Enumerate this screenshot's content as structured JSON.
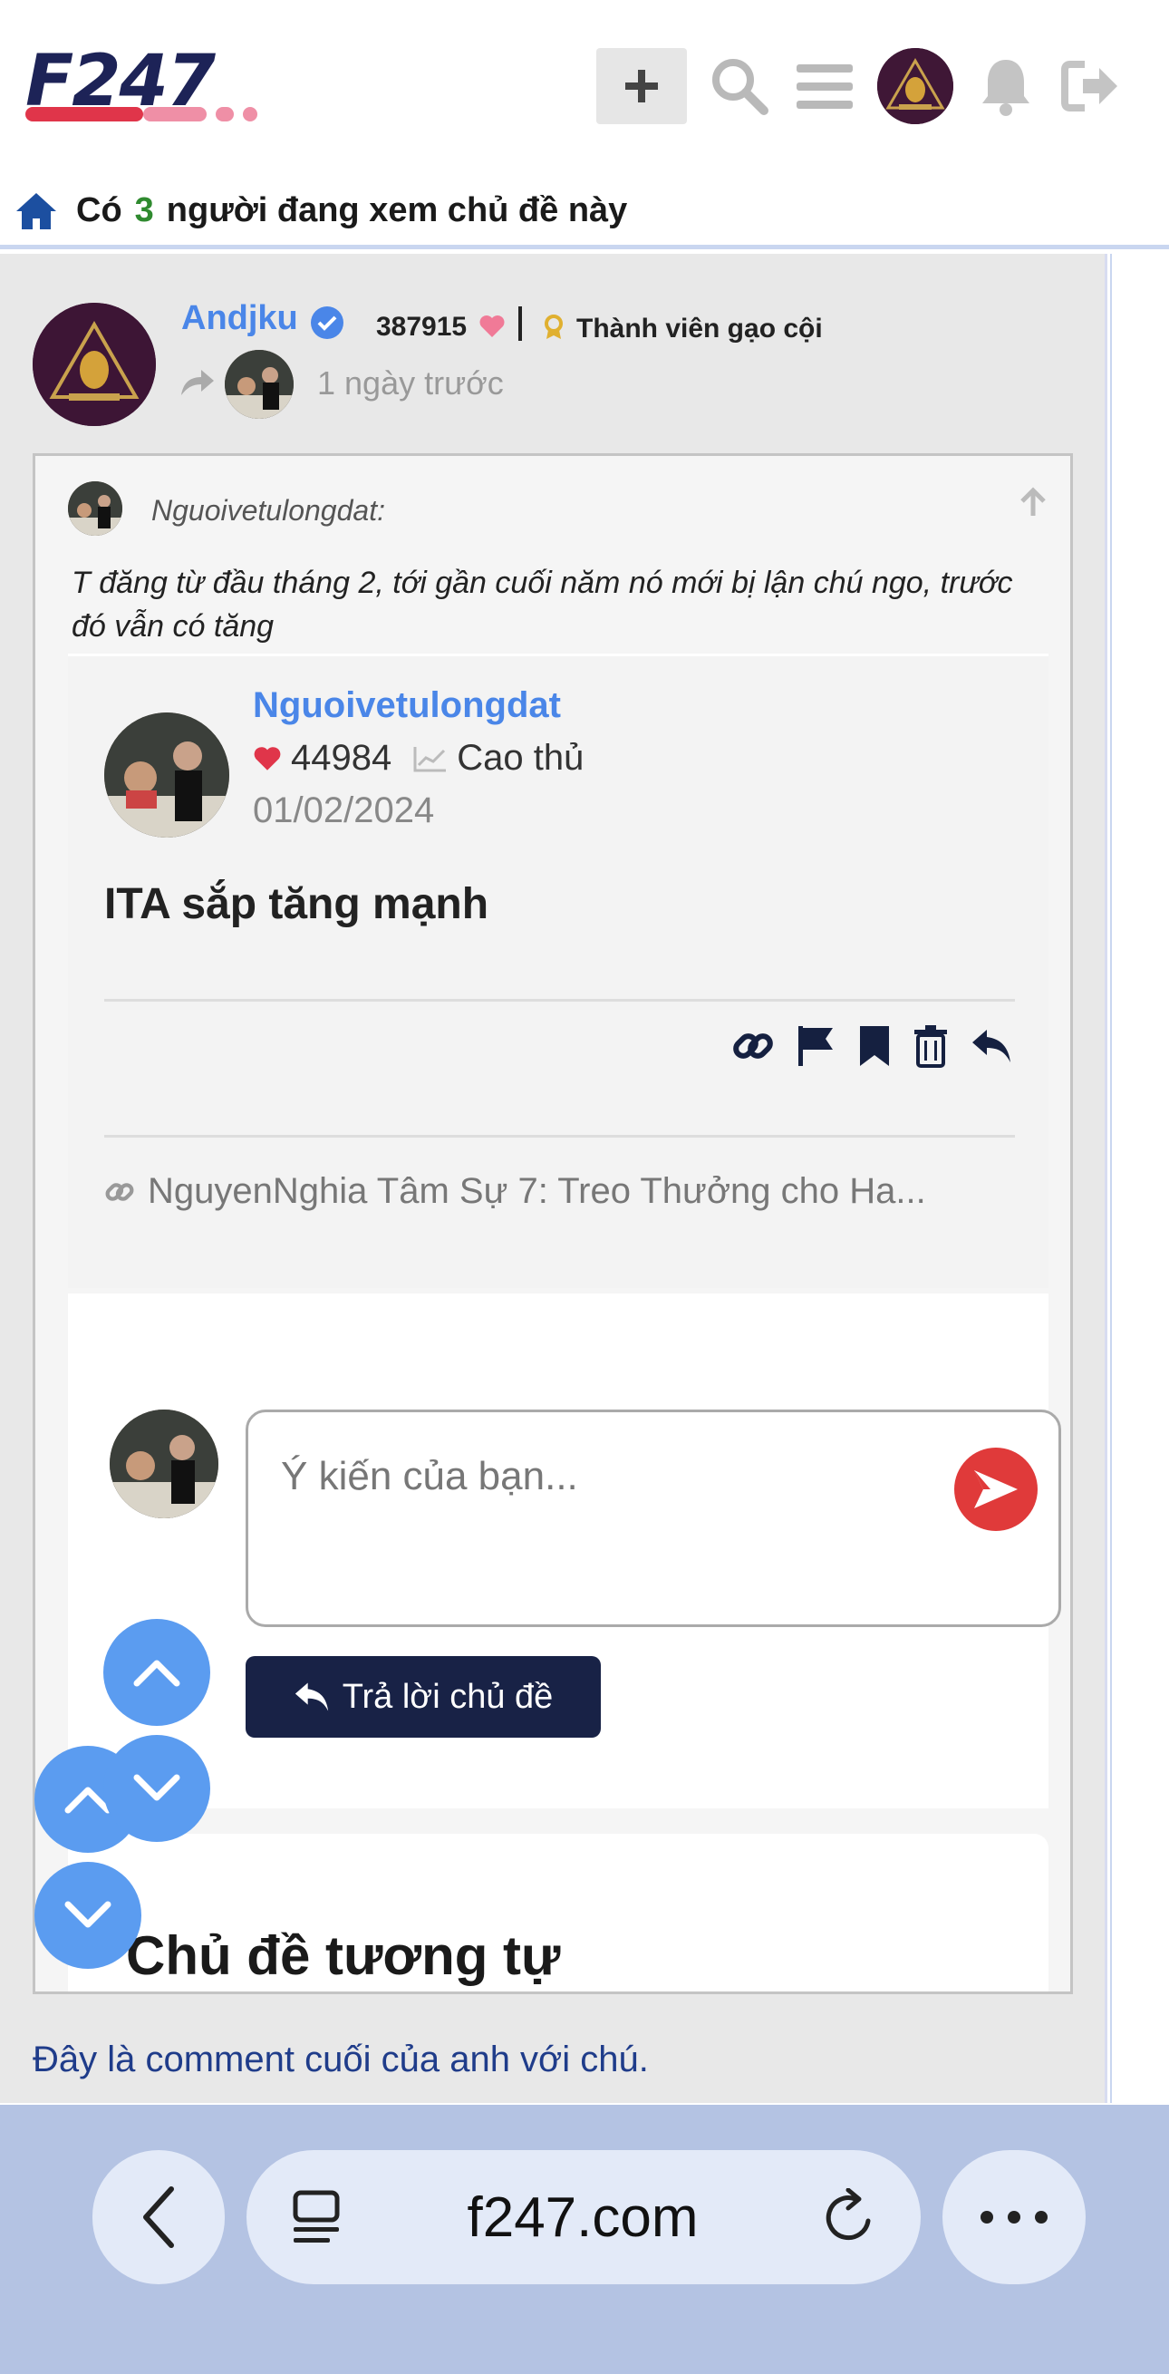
{
  "header": {
    "logo_text": "F247",
    "viewers_prefix": "Có",
    "viewers_count": "3",
    "viewers_suffix": "người đang xem chủ đề này"
  },
  "post": {
    "author": "Andjku",
    "score": "387915",
    "rank": "Thành viên gạo cội",
    "time": "1 ngày trước"
  },
  "quote": {
    "author": "Nguoivetulongdat:",
    "text": "T đăng từ đầu tháng 2, tới gần cuối năm nó mới bị lận chú ngo, trước đó vẫn có tăng"
  },
  "inner_post": {
    "author": "Nguoivetulongdat",
    "score": "44984",
    "rank": "Cao thủ",
    "date": "01/02/2024",
    "title": "ITA sắp tăng mạnh",
    "link": "NguyenNghia Tâm Sự 7: Treo Thưởng cho Ha..."
  },
  "reply": {
    "placeholder": "Ý kiến của bạn...",
    "button_label": "Trả lời chủ đề"
  },
  "similar": {
    "title": "Chủ đề tương tự"
  },
  "bottom_note": "Đây là comment cuối của anh với chú.",
  "browser": {
    "url": "f247.com"
  },
  "colors": {
    "brand_navy": "#1d2357",
    "link_blue": "#4a86e8",
    "accent_red": "#e03a3a",
    "fab_blue": "#5b9cf0",
    "browser_bar": "#b4c3e3"
  }
}
